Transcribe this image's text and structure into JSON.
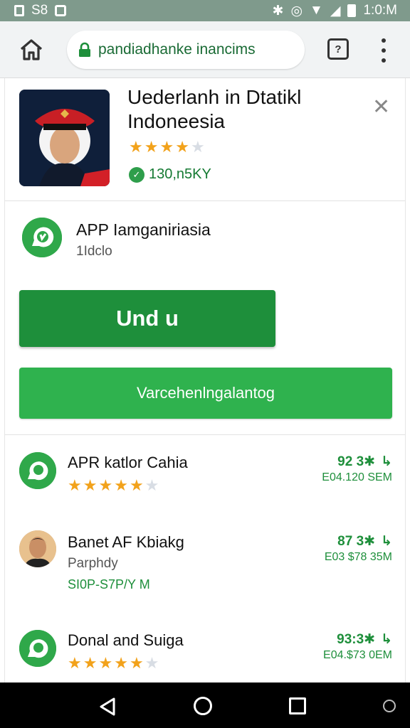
{
  "status_bar": {
    "left_text": "S8",
    "time": "1:0:M"
  },
  "browser": {
    "url": "pandiadhanke inancims",
    "tabs_label": "?"
  },
  "hero": {
    "title": "Uederlanh in Dtatikl Indoneesia",
    "rating": 3.5,
    "downloads": "130,n5KY"
  },
  "app": {
    "name": "APP Iamganiriasia",
    "sub": "1Idclo"
  },
  "buttons": {
    "primary_label": "Und u",
    "secondary_label": "Varcehenlngalantog"
  },
  "rows": [
    {
      "name": "APR katlor Cahia",
      "sub": "",
      "price": "",
      "rating": 4.5,
      "stat_top": "92 3✱",
      "stat_bottom": "E04.120 SEM"
    },
    {
      "name": "Banet AF Kbiakg",
      "sub": "Parphdy",
      "price": "SI0P-S7P/Y M",
      "rating": null,
      "stat_top": "87 3✱",
      "stat_bottom": "E03 $78 35M"
    },
    {
      "name": "Donal and Suiga",
      "sub": "",
      "price": "",
      "rating": 4.5,
      "stat_top": "93:3✱",
      "stat_bottom": "E04.$73 0EM"
    }
  ],
  "colors": {
    "primary_green": "#1e8f3b",
    "secondary_green": "#2fb24e",
    "star": "#f2a21b"
  }
}
